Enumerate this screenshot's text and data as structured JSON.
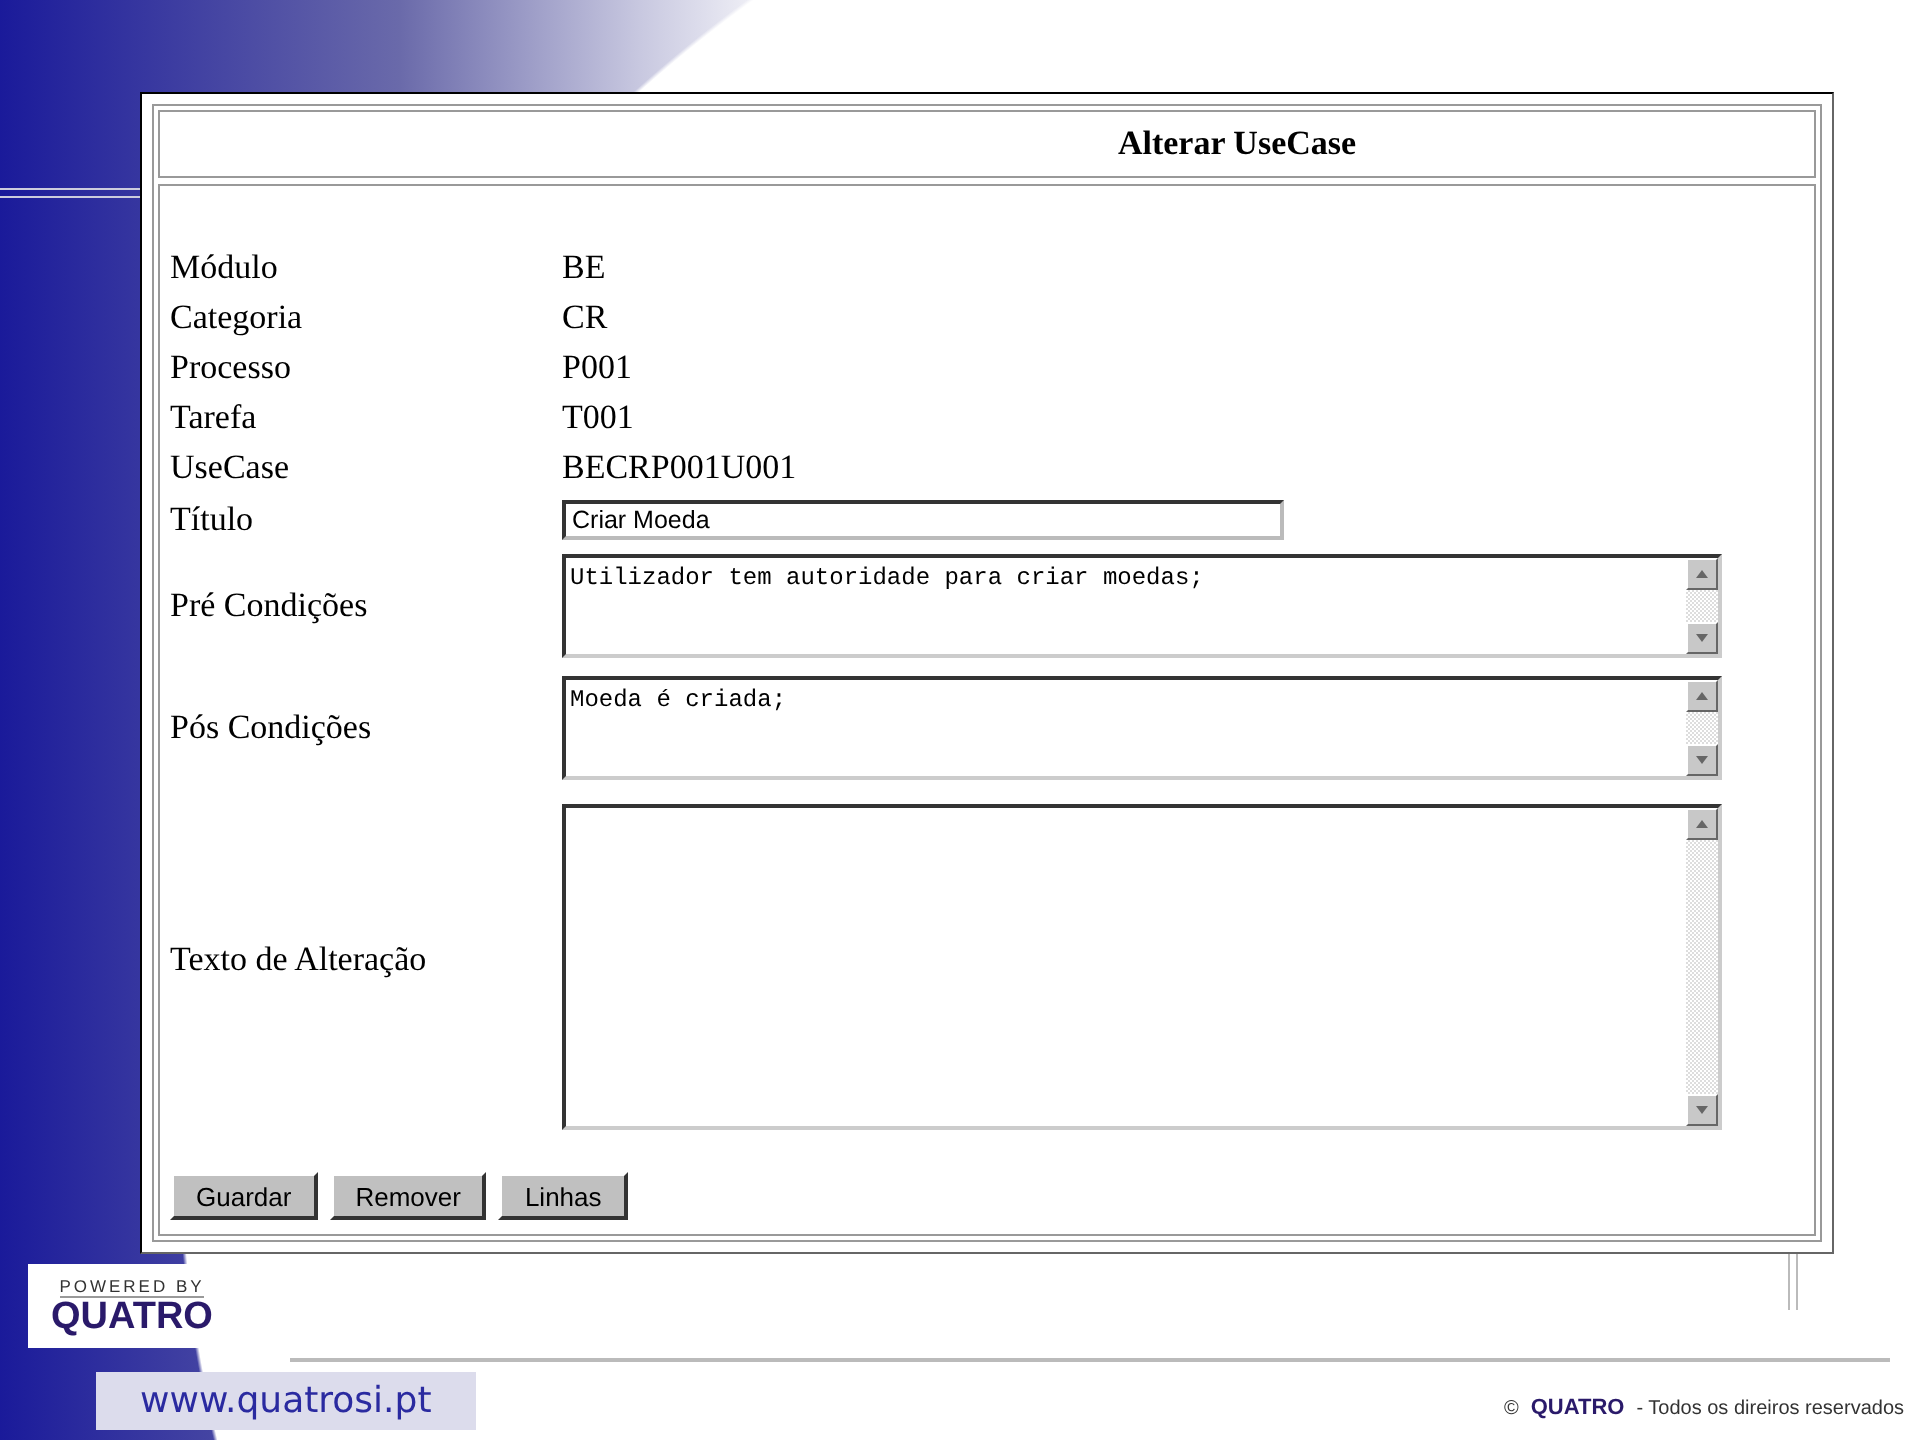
{
  "form": {
    "title": "Alterar UseCase",
    "fields": [
      {
        "label": "Módulo",
        "kind": "text",
        "value": "BE"
      },
      {
        "label": "Categoria",
        "kind": "text",
        "value": "CR"
      },
      {
        "label": "Processo",
        "kind": "text",
        "value": "P001"
      },
      {
        "label": "Tarefa",
        "kind": "text",
        "value": "T001"
      },
      {
        "label": "UseCase",
        "kind": "text",
        "value": "BECRP001U001"
      },
      {
        "label": "Título",
        "kind": "input",
        "value": "Criar Moeda"
      },
      {
        "label": "Pré Condições",
        "kind": "textarea",
        "value": "Utilizador tem autoridade para criar moedas;"
      },
      {
        "label": "Pós Condições",
        "kind": "textarea",
        "value": "Moeda é criada;"
      },
      {
        "label": "Texto de Alteração",
        "kind": "textarea_large"
      }
    ],
    "buttons": [
      "Guardar",
      "Remover",
      "Linhas"
    ]
  },
  "branding": {
    "logo_caption": "POWERED BY",
    "logo_name": "QUATRO",
    "url": "www.quatrosi.pt",
    "copyright_symbol": "©",
    "copyright_brand": "QUATRO",
    "copyright_text": "- Todos os direiros reservados"
  }
}
